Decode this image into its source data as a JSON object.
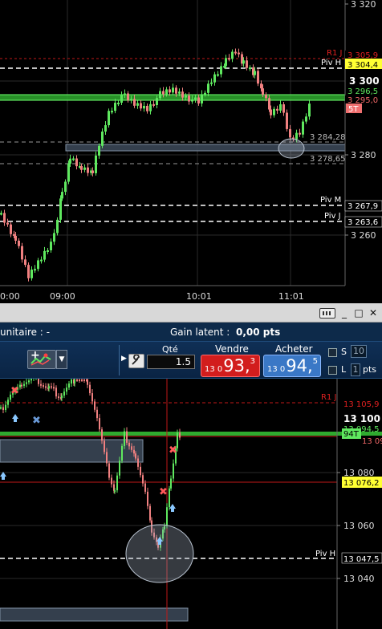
{
  "top_chart": {
    "price_ticks": [
      "3 320",
      "3 300",
      "3 280",
      "3 260"
    ],
    "time_ticks": [
      "0:00",
      "09:00",
      "10:01",
      "11:01"
    ],
    "levels": {
      "r1": {
        "name": "R1 J",
        "value": "3 305,9"
      },
      "pivh": {
        "name": "Piv H",
        "value": "3 304,4"
      },
      "green_a": {
        "value": "3 296,5"
      },
      "green_b": {
        "value": "3 295,0"
      },
      "st": {
        "name": "5T"
      },
      "low_a": {
        "value": "3 284,28"
      },
      "low_b": {
        "value": "3 278,65"
      },
      "pivm": {
        "name": "Piv M",
        "value": "3 267,9"
      },
      "pivj": {
        "name": "Piv J",
        "value": "3 263,6"
      }
    }
  },
  "window_controls": {
    "minimize": "_",
    "restore": "□",
    "close": "✕"
  },
  "info_bar": {
    "unit_label": "unitaire :",
    "unit_value": "-",
    "gain_label": "Gain latent :",
    "gain_value": "0,00 pts"
  },
  "toolbar": {
    "strategy_plus": "+",
    "dropdown_icon": "chevron-down-icon",
    "collapse_icon": "triangle-right-icon",
    "wrench_icon": "wrench-icon",
    "qty_label": "Qté",
    "qty_value": "1.5",
    "sell_label": "Vendre",
    "sell_prefix": "13 0",
    "sell_big": "93,",
    "sell_sup": "3",
    "buy_label": "Acheter",
    "buy_prefix": "13 0",
    "buy_big": "94,",
    "buy_sup": "5",
    "s_label": "S",
    "s_value": "10",
    "s_unit": "pts",
    "l_label": "L",
    "l_value": "1",
    "l_unit": "pts"
  },
  "bottom_chart": {
    "price_ticks": [
      "13 100",
      "13 080",
      "13 060",
      "13 040"
    ],
    "levels": {
      "r1": {
        "name": "R1 J",
        "value": "13 105,9"
      },
      "green_a": {
        "value": "13 094,5"
      },
      "tag": {
        "name": "94T"
      },
      "green_b": {
        "value": "13 093,3"
      },
      "cursor": {
        "value": "13 076,2"
      },
      "pivh": {
        "name": "Piv H",
        "value": "13 047,5"
      }
    }
  },
  "colors": {
    "bull": "#5fe85f",
    "bear": "#f08080",
    "green_level": "#3ad23a",
    "red_level": "#d02020",
    "cursor_yellow": "#ffff00",
    "sell": "#d21d1d",
    "buy": "#3a78c6"
  }
}
